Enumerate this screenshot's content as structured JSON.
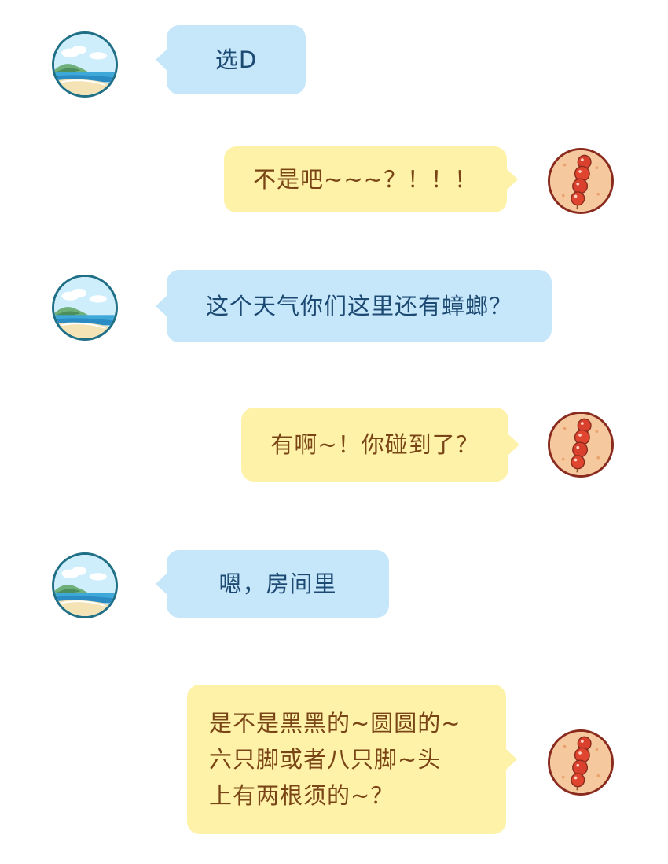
{
  "messages": [
    {
      "side": "left",
      "text": "选D"
    },
    {
      "side": "right",
      "text": "不是吧~~~？！！！"
    },
    {
      "side": "left",
      "text": "这个天气你们这里还有蟑螂？"
    },
    {
      "side": "right",
      "text": "有啊~！你碰到了？"
    },
    {
      "side": "left",
      "text": "嗯，房间里"
    },
    {
      "side": "right",
      "lines": [
        "是不是黑黑的~圆圆的~",
        "六只脚或者八只脚~头",
        "上有两根须的~？"
      ]
    }
  ],
  "avatars": {
    "left": "beach-avatar-icon",
    "right": "candied-haws-avatar-icon"
  },
  "colors": {
    "left_bubble": "#c6e6fa",
    "right_bubble": "#fdf2a8",
    "left_text": "#1c4a73",
    "right_text": "#7a4516"
  }
}
